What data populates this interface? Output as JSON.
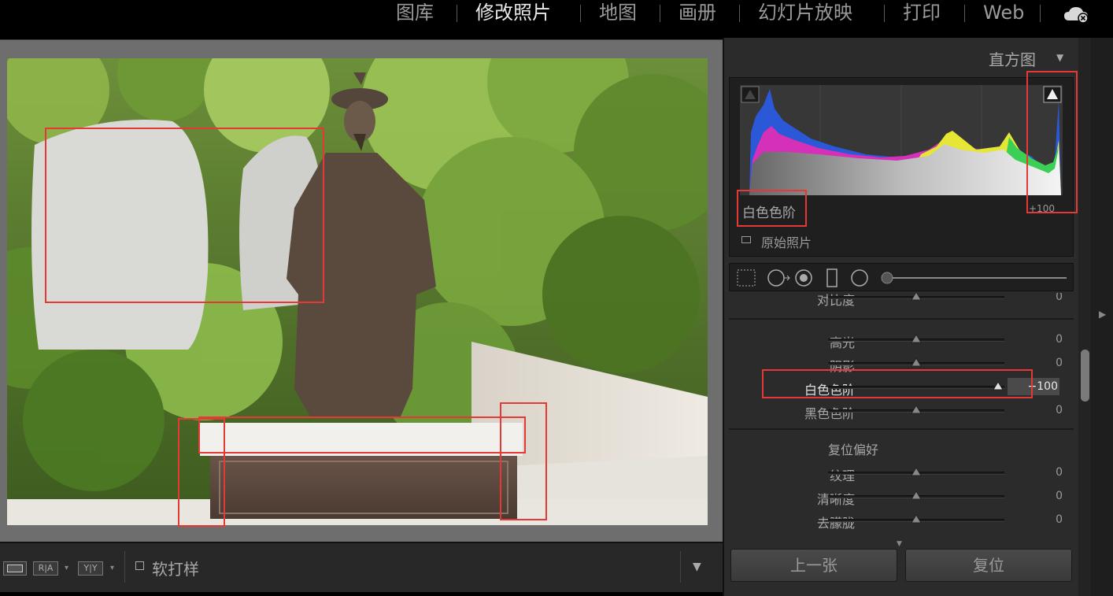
{
  "modules": {
    "items": [
      "图库",
      "修改照片",
      "地图",
      "画册",
      "幻灯片放映",
      "打印",
      "Web"
    ],
    "active": "修改照片"
  },
  "histogram": {
    "title": "直方图",
    "label": "白色色阶",
    "value": "+100",
    "original_photo_label": "原始照片"
  },
  "basic": {
    "top_partial_label": "对比度",
    "top_partial_value": "0",
    "tone_sliders": [
      {
        "label": "高光",
        "value": "0",
        "position": 0.5
      },
      {
        "label": "阴影",
        "value": "0",
        "position": 0.5
      },
      {
        "label": "白色色阶",
        "value": "+100",
        "position": 1.0,
        "active": true
      },
      {
        "label": "黑色色阶",
        "value": "0",
        "position": 0.5
      }
    ],
    "presence_title": "复位偏好",
    "presence_sliders": [
      {
        "label": "纹理",
        "value": "0",
        "position": 0.5
      },
      {
        "label": "清晰度",
        "value": "0",
        "position": 0.5
      },
      {
        "label": "去朦胧",
        "value": "0",
        "position": 0.5
      }
    ]
  },
  "navigation": {
    "previous": "上一张",
    "reset": "复位"
  },
  "toolbar": {
    "view_compare_ra": "R|A",
    "view_compare_yy": "Y|Y",
    "soft_proof": "软打样"
  },
  "colors": {
    "annotation": "#e53935",
    "panel_bg": "#2b2b2b",
    "photo_border": "#6e6e6e"
  }
}
